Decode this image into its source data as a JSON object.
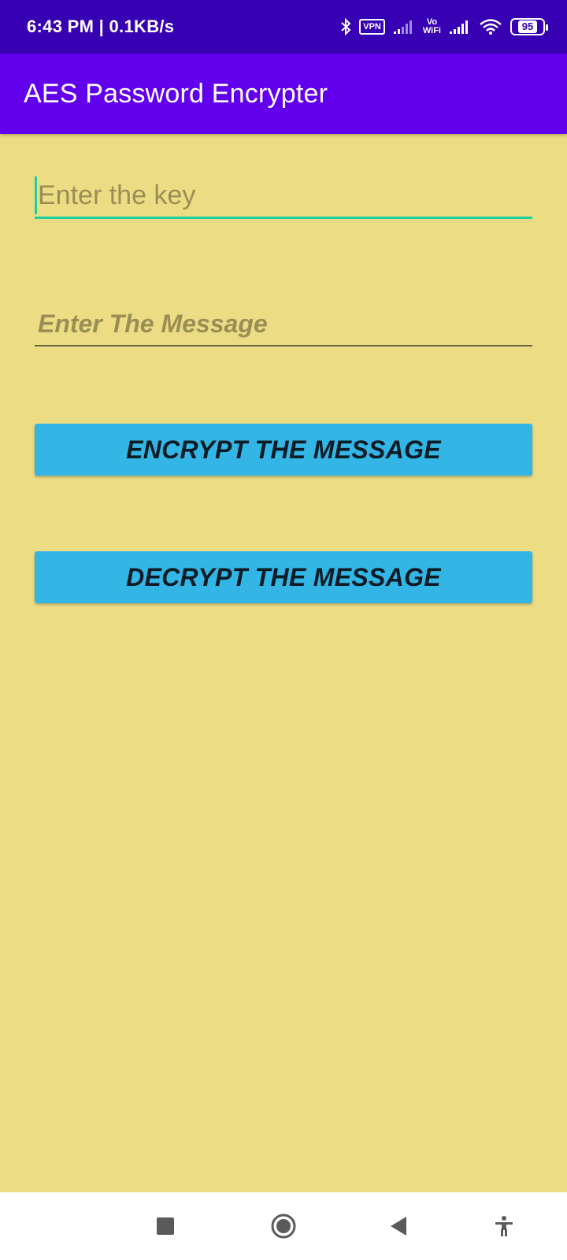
{
  "status_bar": {
    "time": "6:43 PM | 0.1KB/s",
    "vpn_label": "VPN",
    "vowifi_top": "Vo",
    "vowifi_bottom": "WiFi",
    "battery": "95",
    "icons": [
      "bluetooth-icon",
      "vpn-icon",
      "signal-icon",
      "vowifi-icon",
      "signal-icon",
      "wifi-icon",
      "battery-icon"
    ]
  },
  "app_bar": {
    "title": "AES Password Encrypter"
  },
  "form": {
    "key_placeholder": "Enter the key",
    "key_value": "",
    "message_placeholder": "Enter The Message",
    "message_value": ""
  },
  "buttons": {
    "encrypt": "ENCRYPT THE MESSAGE",
    "decrypt": "DECRYPT THE MESSAGE"
  },
  "nav_bar": {
    "icons": [
      "recents-icon",
      "home-icon",
      "back-icon",
      "accessibility-icon"
    ]
  },
  "colors": {
    "status_bar": "#3700b3",
    "app_bar": "#6200ee",
    "background": "#ecdd84",
    "button": "#33b5e5",
    "focus_accent": "#1ecfa0"
  }
}
